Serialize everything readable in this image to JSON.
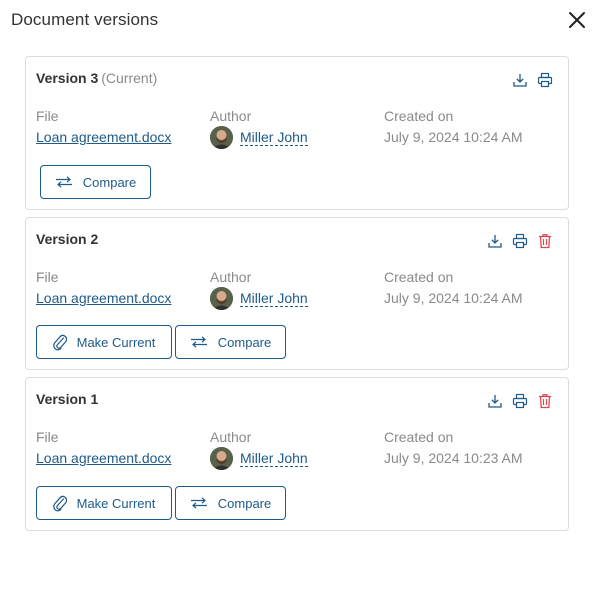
{
  "dialog": {
    "title": "Document versions"
  },
  "labels": {
    "file": "File",
    "author": "Author",
    "created_on": "Created on",
    "compare": "Compare",
    "make_current": "Make Current"
  },
  "colors": {
    "accent": "#1e5a8a",
    "danger": "#e0464e",
    "muted": "#8a8a8a",
    "border": "#dcdcdc"
  },
  "versions": [
    {
      "title": "Version 3",
      "status": "(Current)",
      "file": "Loan agreement.docx",
      "author": "Miller John",
      "created_on": "July 9, 2024 10:24 AM",
      "icons": [
        "download-icon",
        "print-icon"
      ]
    },
    {
      "title": "Version 2",
      "status": "",
      "file": "Loan agreement.docx",
      "author": "Miller John",
      "created_on": "July 9, 2024 10:24 AM",
      "icons": [
        "download-icon",
        "print-icon",
        "delete-icon"
      ]
    },
    {
      "title": "Version 1",
      "status": "",
      "file": "Loan agreement.docx",
      "author": "Miller John",
      "created_on": "July 9, 2024 10:23 AM",
      "icons": [
        "download-icon",
        "print-icon",
        "delete-icon"
      ]
    }
  ]
}
